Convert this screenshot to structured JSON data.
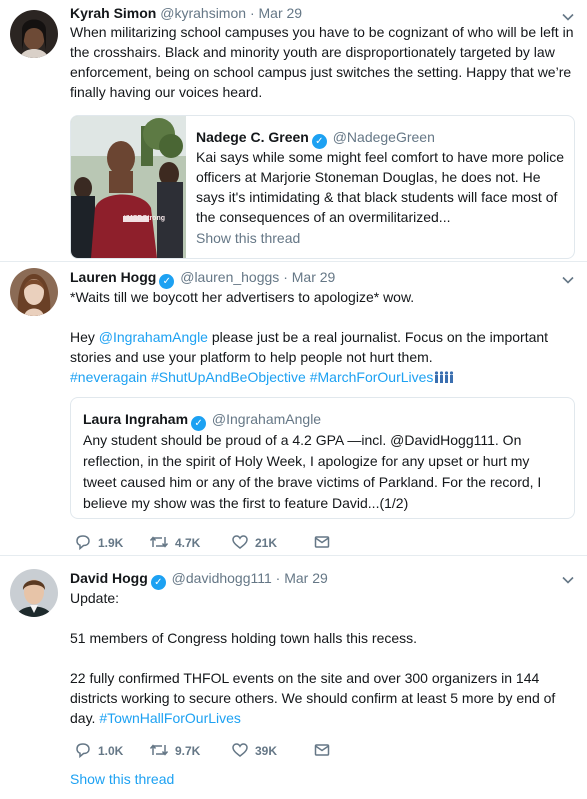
{
  "tweets": [
    {
      "name": "Kyrah Simon",
      "handle": "@kyrahsimon",
      "time": "Mar 29",
      "text": "When militarizing school campuses you have to be cognizant of who will be left in the crosshairs. Black and minority youth are disproportionately targeted by law enforcement, being on school campus just switches the setting. Happy that we’re finally having our voices heard.",
      "quote": {
        "name": "Nadege C. Green",
        "handle": "@NadegeGreen",
        "text": "Kai says while some might feel comfort to have more police officers at Marjorie Stoneman Douglas, he does not. He says it's intimidating & that black students will face most of the consequences of an overmilitarized...",
        "show_thread": "Show this thread",
        "shirt_text": "#MSDStrong"
      }
    },
    {
      "name": "Lauren Hogg",
      "handle": "@lauren_hoggs",
      "time": "Mar 29",
      "line1": "*Waits till we boycott her advertisers to apologize* wow.",
      "p2_pre": "Hey ",
      "mention": "@IngrahamAngle",
      "p2_post": " please just be a real journalist. Focus on the important stories and use your platform to help people not hurt them.",
      "hashtags": "#neveragain #ShutUpAndBeObjective #MarchForOurLives",
      "quote": {
        "name": "Laura Ingraham",
        "handle": "@IngrahamAngle",
        "text": "Any student should be proud of a 4.2 GPA —incl. @DavidHogg111.  On reflection, in the spirit of Holy Week, I apologize for any upset or hurt my tweet caused him or any of the brave victims of Parkland. For the record, I believe my show was the first to feature David...(1/2)"
      },
      "replies": "1.9K",
      "retweets": "4.7K",
      "likes": "21K"
    },
    {
      "name": "David Hogg",
      "handle": "@davidhogg111",
      "time": "Mar 29",
      "p1": "Update:",
      "p2": "51 members of Congress holding town halls this recess.",
      "p3": "22 fully confirmed THFOL events on the site and over 300 organizers in 144 districts working to secure others. We should confirm at least 5 more by end of day. ",
      "hashtag": "#TownHallForOurLives",
      "replies": "1.0K",
      "retweets": "9.7K",
      "likes": "39K",
      "show_thread": "Show this thread"
    }
  ],
  "separator": "·",
  "verified_mark": "✓",
  "icons": {
    "caret": "chevron-down-icon",
    "reply": "reply-icon",
    "retweet": "retweet-icon",
    "like": "heart-icon",
    "message": "envelope-icon",
    "verified": "verified-badge-icon"
  },
  "colors": {
    "link": "#1da1f2",
    "secondary": "#657786",
    "border": "#e6ecf0",
    "verified": "#1da1f2"
  }
}
